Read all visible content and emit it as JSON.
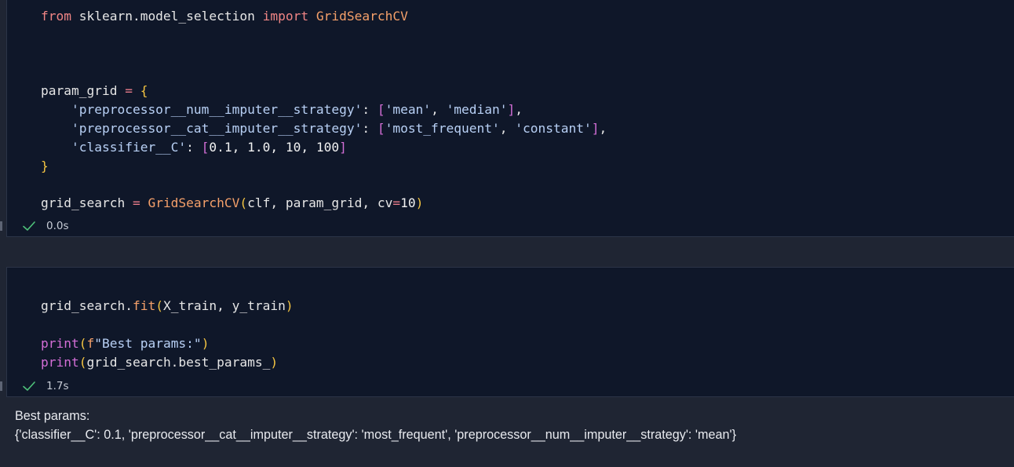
{
  "cells": [
    {
      "code": {
        "import_from": "from",
        "import_module": " sklearn.model_selection ",
        "import_kw": "import",
        "import_name": " GridSearchCV",
        "pg_var": "param_grid ",
        "pg_eq": "=",
        "pg_open": "{",
        "line_num_key": "'preprocessor__num__imputer__strategy'",
        "line_num_colon": ": ",
        "line_num_open": "[",
        "line_num_v1": "'mean'",
        "line_num_comma": ", ",
        "line_num_v2": "'median'",
        "line_num_close": "]",
        "line_num_tail": ",",
        "line_cat_key": "'preprocessor__cat__imputer__strategy'",
        "line_cat_colon": ": ",
        "line_cat_open": "[",
        "line_cat_v1": "'most_frequent'",
        "line_cat_comma": ", ",
        "line_cat_v2": "'constant'",
        "line_cat_close": "]",
        "line_cat_tail": ",",
        "line_c_key": "'classifier__C'",
        "line_c_colon": ": ",
        "line_c_open": "[",
        "line_c_values": "0.1, 1.0, 10, 100",
        "line_c_close": "]",
        "pg_close": "}",
        "gs_var": "grid_search ",
        "gs_eq": "=",
        "gs_fn": " GridSearchCV",
        "gs_open": "(",
        "gs_args": "clf, param_grid, ",
        "gs_cv": "cv",
        "gs_cv_eq": "=",
        "gs_cv_val": "10",
        "gs_close": ")"
      },
      "status": {
        "time": "0.0s"
      }
    },
    {
      "code": {
        "fit_obj": "grid_search.",
        "fit_fn": "fit",
        "fit_open": "(",
        "fit_args": "X_train, y_train",
        "fit_close": ")",
        "print1_fn": "print",
        "print1_open": "(",
        "print1_f": "f",
        "print1_str": "\"Best params:\"",
        "print1_close": ")",
        "print2_fn": "print",
        "print2_open": "(",
        "print2_arg": "grid_search.best_params_",
        "print2_close": ")"
      },
      "status": {
        "time": "1.7s"
      }
    }
  ],
  "output": {
    "line1": "Best params:",
    "line2": "{'classifier__C': 0.1, 'preprocessor__cat__imputer__strategy': 'most_frequent', 'preprocessor__num__imputer__strategy': 'mean'}"
  },
  "colors": {
    "editor_bg": "#0f1729",
    "panel_bg": "#1f2533",
    "keyword": "#f08585",
    "function": "#f5a06a",
    "string": "#b8d0f5",
    "success_check": "#4ec27a"
  },
  "icons": {
    "status_icon": "check-icon"
  }
}
